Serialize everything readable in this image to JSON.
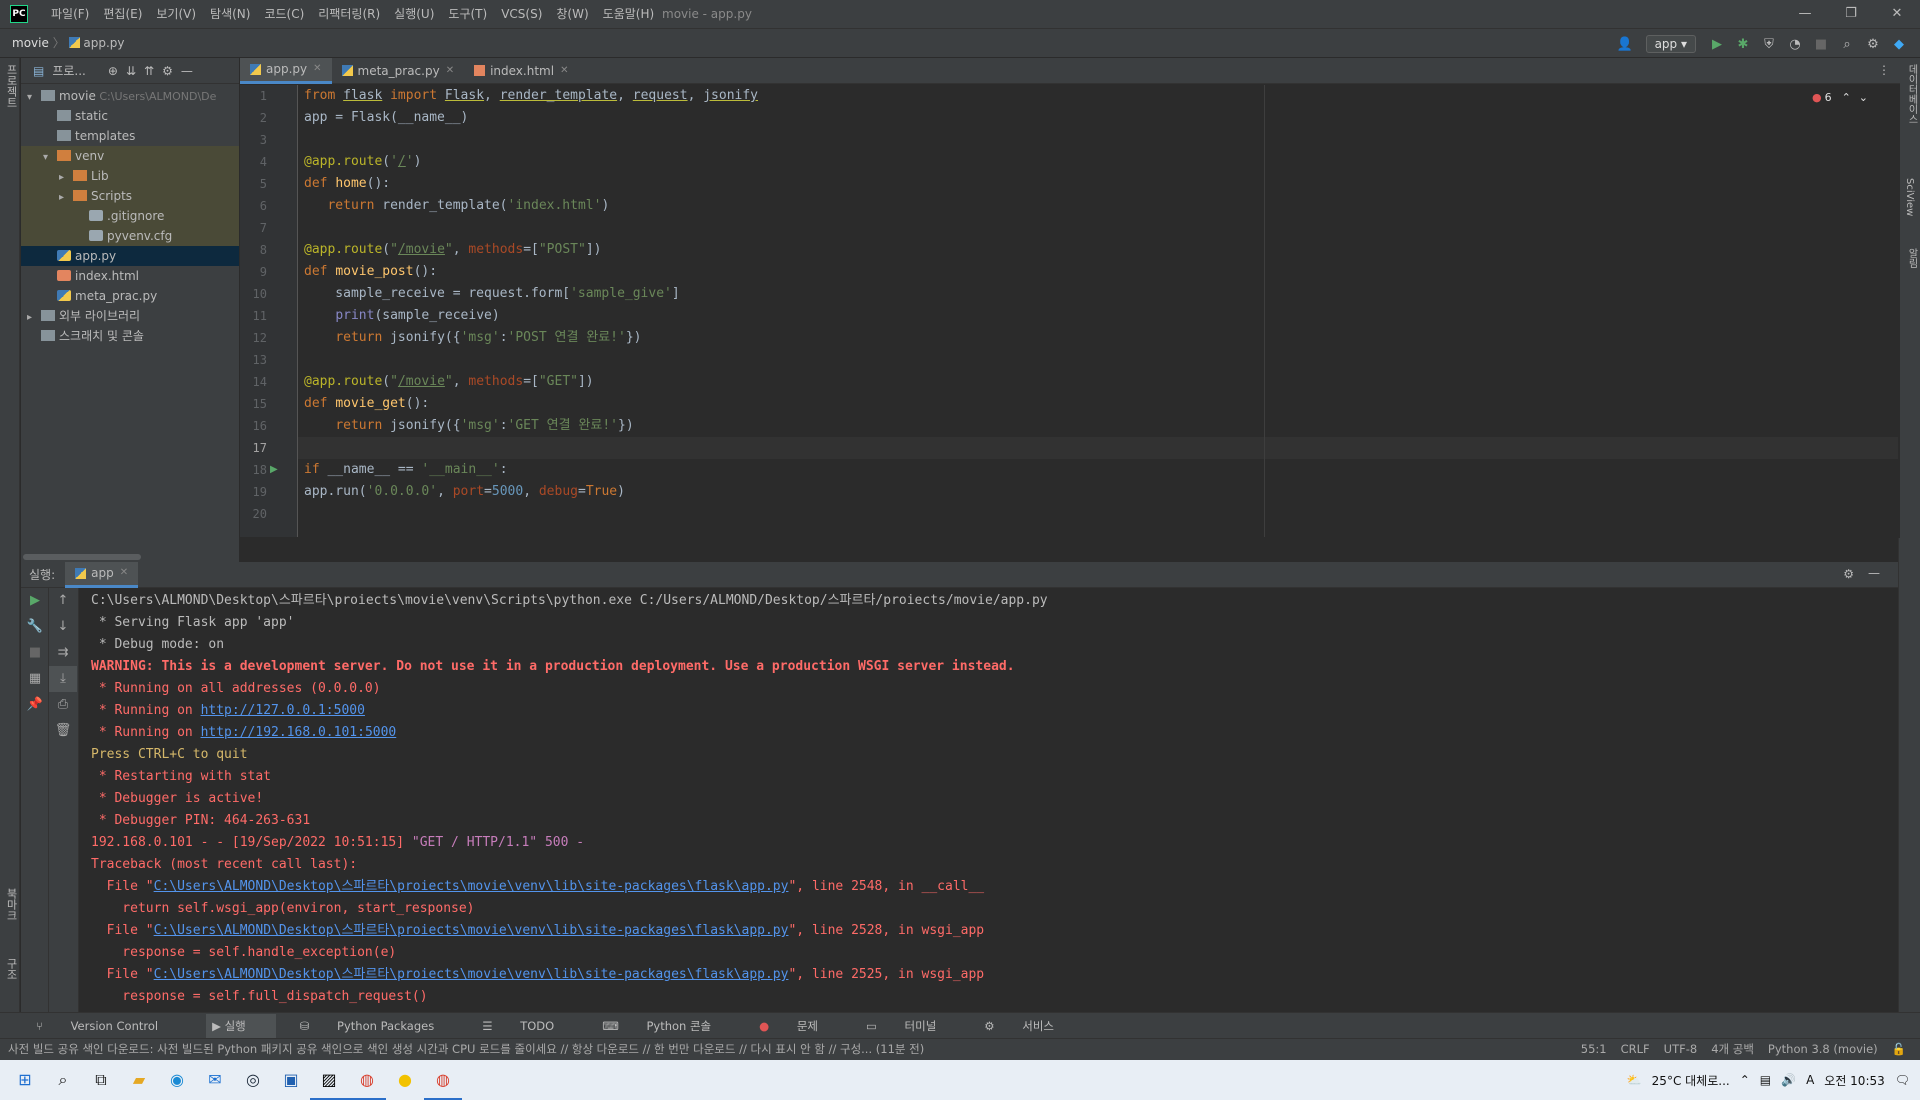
{
  "menubar": {
    "logo": "PC",
    "items": [
      "파일(F)",
      "편집(E)",
      "보기(V)",
      "탐색(N)",
      "코드(C)",
      "리팩터링(R)",
      "실행(U)",
      "도구(T)",
      "VCS(S)",
      "창(W)",
      "도움말(H)"
    ],
    "title": "movie - app.py",
    "win": [
      "—",
      "❐",
      "✕"
    ]
  },
  "navbar": {
    "project": "movie",
    "file": "app.py",
    "run_config": "app"
  },
  "project_panel": {
    "header": "프로...",
    "tree": [
      {
        "label": "movie",
        "extra": "C:\\Users\\ALMOND\\De",
        "depth": 0,
        "arrow": "▾",
        "icon": "folder",
        "cls": ""
      },
      {
        "label": "static",
        "depth": 1,
        "arrow": "",
        "icon": "folder",
        "cls": ""
      },
      {
        "label": "templates",
        "depth": 1,
        "arrow": "",
        "icon": "folder",
        "cls": ""
      },
      {
        "label": "venv",
        "depth": 1,
        "arrow": "▾",
        "icon": "ofolder",
        "cls": "hl"
      },
      {
        "label": "Lib",
        "depth": 2,
        "arrow": "▸",
        "icon": "ofolder",
        "cls": "hl"
      },
      {
        "label": "Scripts",
        "depth": 2,
        "arrow": "▸",
        "icon": "ofolder",
        "cls": "hl"
      },
      {
        "label": ".gitignore",
        "depth": 3,
        "arrow": "",
        "icon": "txtfile",
        "cls": "hl"
      },
      {
        "label": "pyvenv.cfg",
        "depth": 3,
        "arrow": "",
        "icon": "txtfile",
        "cls": "hl"
      },
      {
        "label": "app.py",
        "depth": 1,
        "arrow": "",
        "icon": "pyfile",
        "cls": "sel"
      },
      {
        "label": "index.html",
        "depth": 1,
        "arrow": "",
        "icon": "htmlfile",
        "cls": ""
      },
      {
        "label": "meta_prac.py",
        "depth": 1,
        "arrow": "",
        "icon": "pyfile",
        "cls": ""
      },
      {
        "label": "외부 라이브러리",
        "depth": 0,
        "arrow": "▸",
        "icon": "folder",
        "cls": ""
      },
      {
        "label": "스크래치 및 콘솔",
        "depth": 0,
        "arrow": "",
        "icon": "folder",
        "cls": ""
      }
    ]
  },
  "editor": {
    "tabs": [
      {
        "label": "app.py",
        "active": true
      },
      {
        "label": "meta_prac.py",
        "active": false
      },
      {
        "label": "index.html",
        "active": false
      }
    ],
    "error_count": "6",
    "line_numbers": [
      "1",
      "2",
      "3",
      "4",
      "5",
      "6",
      "7",
      "8",
      "9",
      "10",
      "11",
      "12",
      "13",
      "14",
      "15",
      "16",
      "17",
      "18",
      "19",
      "20"
    ],
    "code": [
      "from flask import Flask, render_template, request, jsonify",
      "app = Flask(__name__)",
      "",
      "@app.route('/')",
      "def home():",
      "   return render_template('index.html')",
      "",
      "@app.route(\"/movie\", methods=[\"POST\"])",
      "def movie_post():",
      "    sample_receive = request.form['sample_give']",
      "    print(sample_receive)",
      "    return jsonify({'msg':'POST 연결 완료!'})",
      "",
      "@app.route(\"/movie\", methods=[\"GET\"])",
      "def movie_get():",
      "    return jsonify({'msg':'GET 연결 완료!'})",
      "",
      "if __name__ == '__main__':",
      "app.run('0.0.0.0', port=5000, debug=True)",
      ""
    ]
  },
  "run_panel": {
    "label": "실행:",
    "tab": "app",
    "lines": [
      {
        "t": "C:\\Users\\ALMOND\\Desktop\\스파르타\\proiects\\movie\\venv\\Scripts\\python.exe C:/Users/ALMOND/Desktop/스파르타/proiects/movie/app.py",
        "c": "c-n"
      },
      {
        "t": " * Serving Flask app 'app'",
        "c": "c-n"
      },
      {
        "t": " * Debug mode: on",
        "c": "c-n"
      },
      {
        "t": "WARNING: This is a development server. Do not use it in a production deployment. Use a production WSGI server instead.",
        "c": "c-w"
      },
      {
        "t": " * Running on all addresses (0.0.0.0)",
        "c": "c-r"
      },
      {
        "t": " * Running on ",
        "c": "c-r",
        "link": "http://127.0.0.1:5000"
      },
      {
        "t": " * Running on ",
        "c": "c-r",
        "link": "http://192.168.0.101:5000"
      },
      {
        "t": "Press CTRL+C to quit",
        "c": "c-y"
      },
      {
        "t": " * Restarting with stat",
        "c": "c-r"
      },
      {
        "t": " * Debugger is active!",
        "c": "c-r"
      },
      {
        "t": " * Debugger PIN: 464-263-631",
        "c": "c-r"
      },
      {
        "t": "192.168.0.101 - - [19/Sep/2022 10:51:15] ",
        "c": "c-r",
        "tail": "\"GET / HTTP/1.1\" 500 -"
      },
      {
        "t": "Traceback (most recent call last):",
        "c": "c-r"
      },
      {
        "t": "  File \"",
        "c": "c-r",
        "link": "C:\\Users\\ALMOND\\Desktop\\스파르타\\proiects\\movie\\venv\\lib\\site-packages\\flask\\app.py",
        "after": "\", line 2548, in __call__"
      },
      {
        "t": "    return self.wsgi_app(environ, start_response)",
        "c": "c-r"
      },
      {
        "t": "  File \"",
        "c": "c-r",
        "link": "C:\\Users\\ALMOND\\Desktop\\스파르타\\proiects\\movie\\venv\\lib\\site-packages\\flask\\app.py",
        "after": "\", line 2528, in wsgi_app"
      },
      {
        "t": "    response = self.handle_exception(e)",
        "c": "c-r"
      },
      {
        "t": "  File \"",
        "c": "c-r",
        "link": "C:\\Users\\ALMOND\\Desktop\\스파르타\\proiects\\movie\\venv\\lib\\site-packages\\flask\\app.py",
        "after": "\", line 2525, in wsgi_app"
      },
      {
        "t": "    response = self.full_dispatch_request()",
        "c": "c-r"
      }
    ]
  },
  "bottom_tabs": [
    "Version Control",
    "▶ 실행",
    "Python Packages",
    "TODO",
    "Python 콘솔",
    "문제",
    "터미널",
    "서비스"
  ],
  "status": {
    "message": "사전 빌드 공유 색인 다운로드: 사전 빌드된 Python 패키지 공유 색인으로 색인 생성 시간과 CPU 로드를 줄이세요 // 항상 다운로드 // 한 번만 다운로드 // 다시 표시 안 함 // 구성... (11분 전)",
    "position": "55:1",
    "line_sep": "CRLF",
    "encoding": "UTF-8",
    "indent": "4개 공백",
    "interpreter": "Python 3.8 (movie)"
  },
  "taskbar": {
    "weather": "25°C 대체로...",
    "time": "오전 10:53",
    "ime": "A"
  },
  "side": {
    "left_top": "프로젝트",
    "left_bottom1": "북마크",
    "left_bottom2": "구조",
    "right1": "데이터베이스",
    "right2": "SciView",
    "right3": "알림"
  }
}
